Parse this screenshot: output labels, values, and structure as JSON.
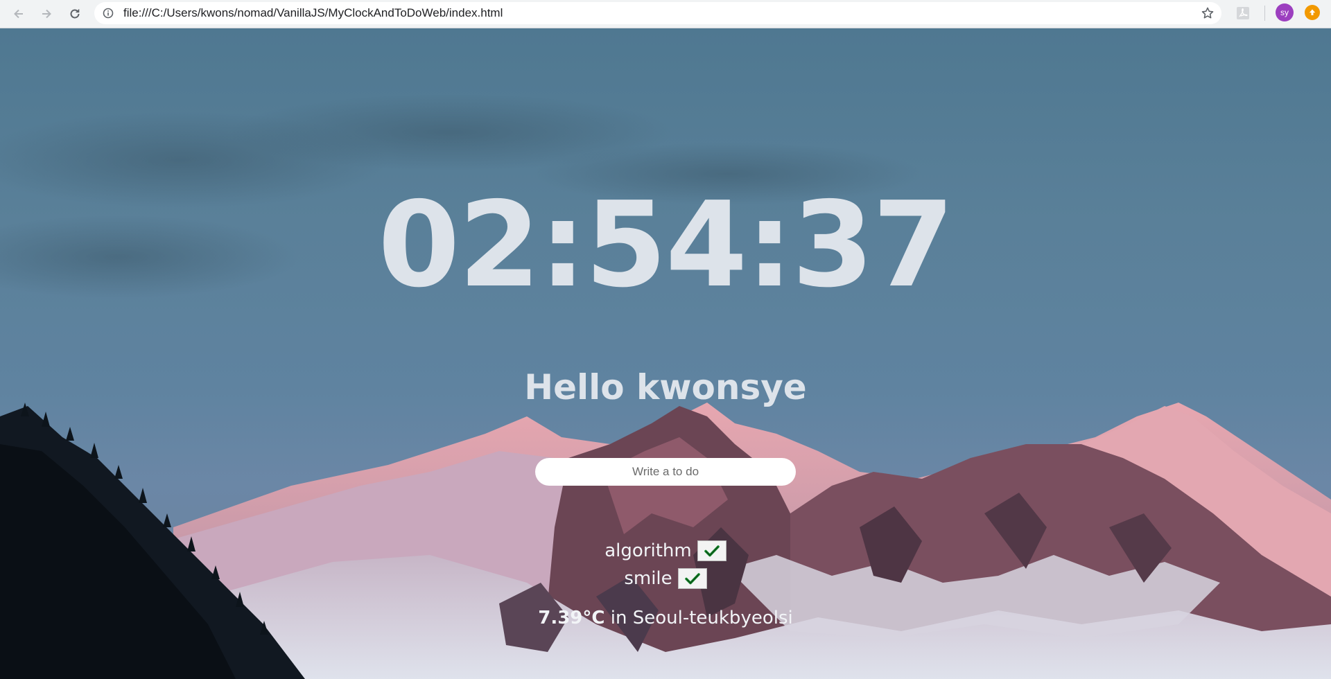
{
  "browser": {
    "url": "file:///C:/Users/kwons/nomad/VanillaJS/MyClockAndToDoWeb/index.html",
    "avatar_initials": "sy",
    "colors": {
      "avatar": "#9c3fbf",
      "update_badge": "#f29900"
    },
    "icons": [
      "back-icon",
      "forward-icon",
      "reload-icon",
      "info-icon",
      "star-icon",
      "pdf-extension-icon",
      "update-icon"
    ]
  },
  "page": {
    "clock": "02:54:37",
    "greeting": "Hello kwonsye",
    "todo_placeholder": "Write a to do",
    "todos": [
      {
        "text": "algorithm",
        "delete_icon": "checkmark-icon"
      },
      {
        "text": "smile",
        "delete_icon": "checkmark-icon"
      }
    ],
    "weather": {
      "temperature": "7.39°C",
      "connector": "in",
      "place": "Seoul-teukbyeolsi"
    },
    "colors": {
      "text": "#dde3ea",
      "sky": "#5a8099",
      "check": "#1a7a2a"
    }
  }
}
